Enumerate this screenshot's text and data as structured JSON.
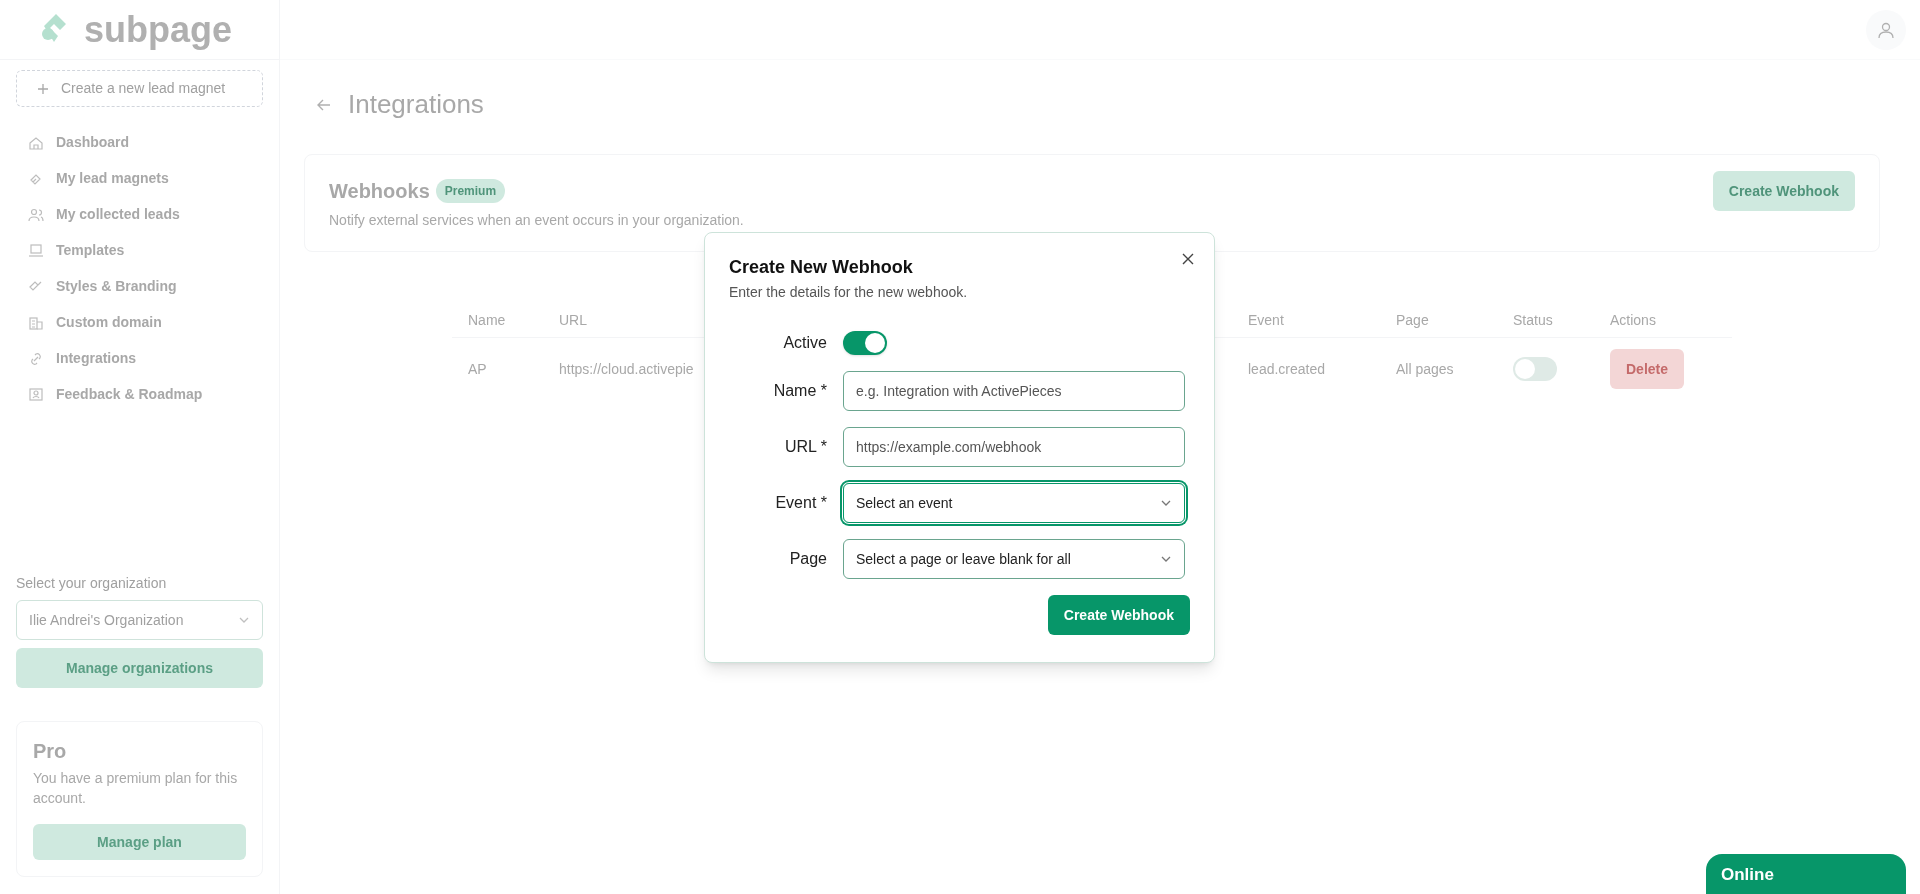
{
  "logo": {
    "text": "subpage"
  },
  "sidebar": {
    "create_button": "Create a new lead magnet",
    "items": [
      {
        "label": "Dashboard"
      },
      {
        "label": "My lead magnets"
      },
      {
        "label": "My collected leads"
      },
      {
        "label": "Templates"
      },
      {
        "label": "Styles & Branding"
      },
      {
        "label": "Custom domain"
      },
      {
        "label": "Integrations"
      },
      {
        "label": "Feedback & Roadmap"
      }
    ],
    "organization": {
      "label": "Select your organization",
      "value": "Ilie Andrei's Organization",
      "manage_button": "Manage organizations"
    },
    "plan": {
      "title": "Pro",
      "description": "You have a premium plan for this account.",
      "button": "Manage plan"
    }
  },
  "page": {
    "title": "Integrations"
  },
  "webhooks_card": {
    "title": "Webhooks",
    "badge": "Premium",
    "description": "Notify external services when an event occurs in your organization.",
    "create_button": "Create Webhook"
  },
  "table": {
    "columns": [
      "Name",
      "URL",
      "Event",
      "Page",
      "Status",
      "Actions"
    ],
    "rows": [
      {
        "cells": [
          "AP",
          "https://cloud.activepie",
          "lead.created",
          "All pages"
        ],
        "on": false,
        "action": "Delete"
      }
    ]
  },
  "modal": {
    "title": "Create New Webhook",
    "subtitle": "Enter the details for the new webhook.",
    "fields": [
      {
        "kind": "toggle",
        "label": "Active",
        "on": true
      },
      {
        "kind": "text",
        "label": "Name *",
        "placeholder": "e.g. Integration with ActivePieces"
      },
      {
        "kind": "text",
        "label": "URL *",
        "placeholder": "https://example.com/webhook"
      },
      {
        "kind": "select",
        "label": "Event *",
        "text": "Select an event",
        "focused": true
      },
      {
        "kind": "select",
        "label": "Page",
        "text": "Select a page or leave blank for all",
        "focused": false
      }
    ],
    "submit": "Create Webhook"
  },
  "chat": {
    "label": "Online"
  }
}
